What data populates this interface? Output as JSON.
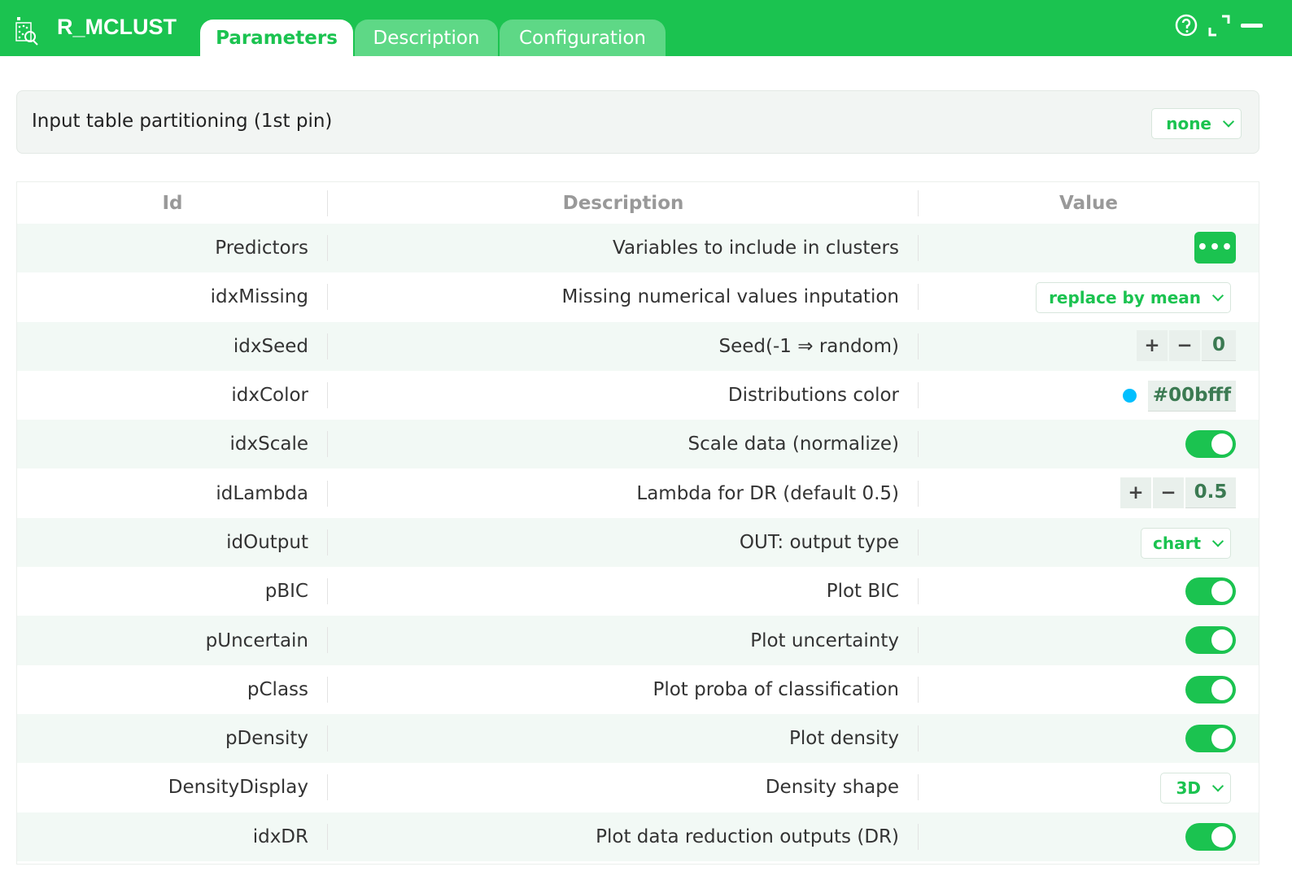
{
  "app": {
    "title": "R_MCLUST"
  },
  "tabs": [
    {
      "label": "Parameters",
      "active": true
    },
    {
      "label": "Description",
      "active": false
    },
    {
      "label": "Configuration",
      "active": false
    }
  ],
  "partition": {
    "label": "Input table partitioning (1st pin)",
    "value": "none"
  },
  "table": {
    "headers": {
      "id": "Id",
      "description": "Description",
      "value": "Value"
    },
    "rows": [
      {
        "id": "Predictors",
        "description": "Variables to include in clusters",
        "type": "more",
        "value": "•••"
      },
      {
        "id": "idxMissing",
        "description": "Missing numerical values inputation",
        "type": "select",
        "value": "replace by mean"
      },
      {
        "id": "idxSeed",
        "description": "Seed(-1 ⇒ random)",
        "type": "stepper",
        "value": "0"
      },
      {
        "id": "idxColor",
        "description": "Distributions color",
        "type": "color",
        "value": "#00bfff"
      },
      {
        "id": "idxScale",
        "description": "Scale data (normalize)",
        "type": "toggle",
        "value": true
      },
      {
        "id": "idLambda",
        "description": "Lambda for DR (default 0.5)",
        "type": "stepper",
        "value": "0.5"
      },
      {
        "id": "idOutput",
        "description": "OUT: output type",
        "type": "select",
        "value": "chart"
      },
      {
        "id": "pBIC",
        "description": "Plot BIC",
        "type": "toggle",
        "value": true
      },
      {
        "id": "pUncertain",
        "description": "Plot uncertainty",
        "type": "toggle",
        "value": true
      },
      {
        "id": "pClass",
        "description": "Plot proba of classification",
        "type": "toggle",
        "value": true
      },
      {
        "id": "pDensity",
        "description": "Plot density",
        "type": "toggle",
        "value": true
      },
      {
        "id": "DensityDisplay",
        "description": "Density shape",
        "type": "select",
        "value": "3D"
      },
      {
        "id": "idxDR",
        "description": "Plot data reduction outputs (DR)",
        "type": "toggle",
        "value": true
      }
    ]
  },
  "stepper": {
    "plus": "+",
    "minus": "−"
  },
  "colors": {
    "accent": "#1bc350",
    "swatch": "#00bfff"
  }
}
